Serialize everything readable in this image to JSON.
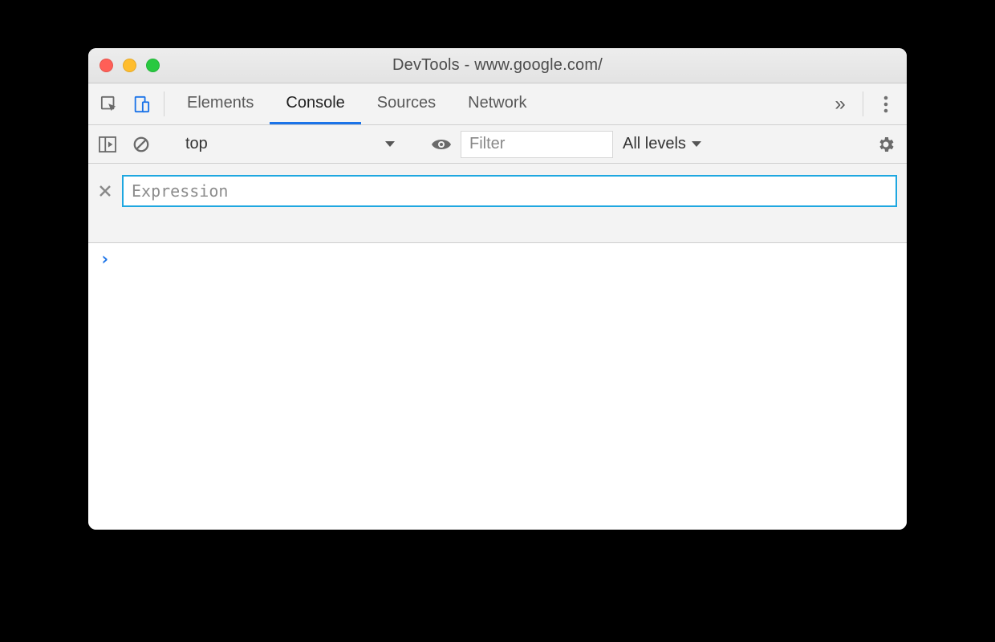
{
  "window": {
    "title": "DevTools - www.google.com/"
  },
  "tabs": {
    "items": [
      {
        "label": "Elements",
        "active": false
      },
      {
        "label": "Console",
        "active": true
      },
      {
        "label": "Sources",
        "active": false
      },
      {
        "label": "Network",
        "active": false
      }
    ],
    "overflow_glyph": "»"
  },
  "toolbar": {
    "context": "top",
    "filter_placeholder": "Filter",
    "loglevels_label": "All levels"
  },
  "live_expression": {
    "placeholder": "Expression",
    "value": ""
  },
  "console": {
    "prompt_glyph": "›"
  }
}
